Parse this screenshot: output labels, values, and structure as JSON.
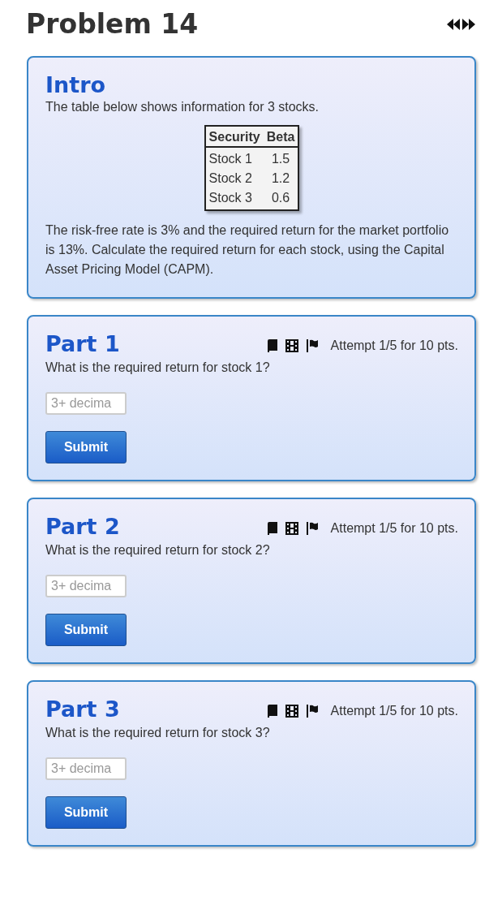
{
  "title": "Problem 14",
  "intro": {
    "heading": "Intro",
    "text": "The table below shows information for 3 stocks.",
    "table": {
      "columns": [
        "Security",
        "Beta"
      ],
      "rows": [
        [
          "Stock 1",
          "1.5"
        ],
        [
          "Stock 2",
          "1.2"
        ],
        [
          "Stock 3",
          "0.6"
        ]
      ]
    },
    "body": "The risk-free rate is 3% and the required return for the market portfolio is 13%. Calculate the required return for each stock, using the Capital Asset Pricing Model (CAPM)."
  },
  "parts": [
    {
      "heading": "Part 1",
      "attempt": "Attempt 1/5 for 10 pts.",
      "question": "What is the required return for stock 1?",
      "placeholder": "3+ decima",
      "button": "Submit"
    },
    {
      "heading": "Part 2",
      "attempt": "Attempt 1/5 for 10 pts.",
      "question": "What is the required return for stock 2?",
      "placeholder": "3+ decima",
      "button": "Submit"
    },
    {
      "heading": "Part 3",
      "attempt": "Attempt 1/5 for 10 pts.",
      "question": "What is the required return for stock 3?",
      "placeholder": "3+ decima",
      "button": "Submit"
    }
  ]
}
